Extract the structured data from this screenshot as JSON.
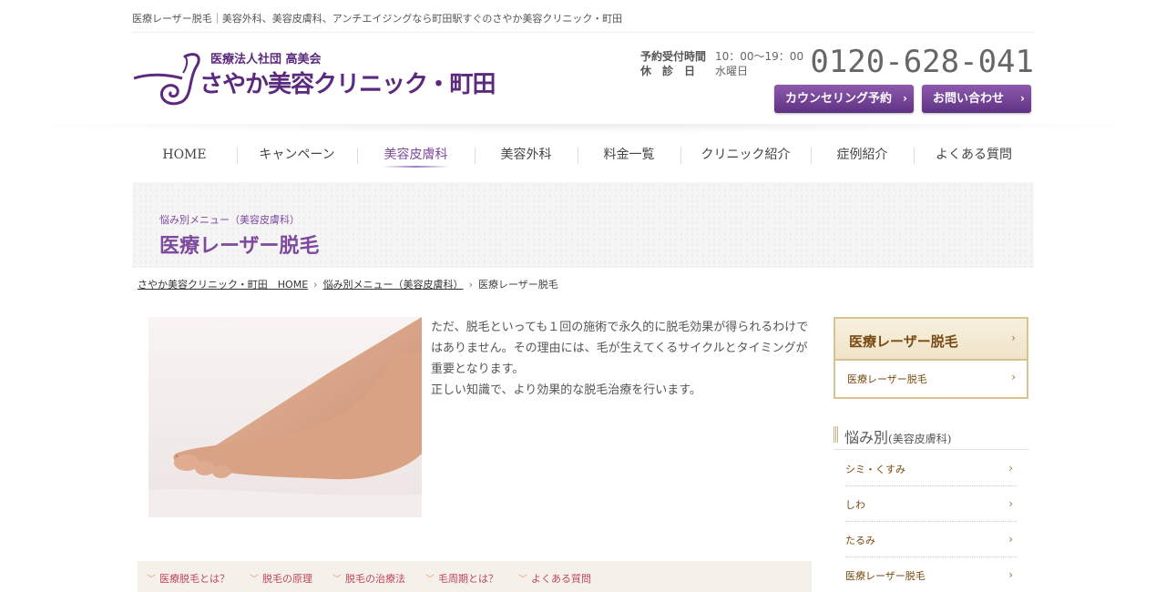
{
  "topbar": {
    "tagline": "医療レーザー脱毛｜美容外科、美容皮膚科、アンチエイジングなら町田駅すぐのさやか美容クリニック・町田"
  },
  "header": {
    "corp": "医療法人社団 高美会",
    "clinic_name": "さやか美容クリニック・町田",
    "hours_label": "予約受付時間",
    "hours_value": "10：00〜19：00",
    "closed_label": "休　診　日",
    "closed_value": "水曜日",
    "tel": "0120-628-041",
    "counsel_button": "カウンセリング予約",
    "contact_button": "お問い合わせ",
    "brand_color": "#5b2a7e"
  },
  "nav": {
    "items": [
      {
        "label": "HOME",
        "width": 115
      },
      {
        "label": "キャンペーン",
        "width": 132
      },
      {
        "label": "美容皮膚科",
        "width": 129
      },
      {
        "label": "美容外科",
        "width": 113
      },
      {
        "label": "料金一覧",
        "width": 113
      },
      {
        "label": "クリニック紹介",
        "width": 143
      },
      {
        "label": "症例紹介",
        "width": 113
      },
      {
        "label": "よくある質問",
        "width": 132
      }
    ],
    "active": "美容皮膚科"
  },
  "title_band": {
    "sub": "悩み別メニュー（美容皮膚科）",
    "main": "医療レーザー脱毛"
  },
  "breadcrumb": {
    "home": "さやか美容クリニック・町田　HOME",
    "parent": "悩み別メニュー（美容皮膚科）",
    "current": "医療レーザー脱毛"
  },
  "content": {
    "paragraph1": "ただ、脱毛といっても１回の施術で永久的に脱毛効果が得られるわけではありません。その理由には、毛が生えてくるサイクルとタイミングが重要となります。",
    "paragraph2": "正しい知識で、より効果的な脱毛治療を行います。",
    "anchors": [
      "医療脱毛とは？",
      "脱毛の原理",
      "脱毛の治療法",
      "毛周期とは？",
      "よくある質問"
    ]
  },
  "sidebar": {
    "box_title": "医療レーザー脱毛",
    "box_item": "医療レーザー脱毛",
    "section_title": "悩み別",
    "section_sub": "(美容皮膚科)",
    "items": [
      "シミ・くすみ",
      "しわ",
      "たるみ",
      "医療レーザー脱毛"
    ]
  }
}
